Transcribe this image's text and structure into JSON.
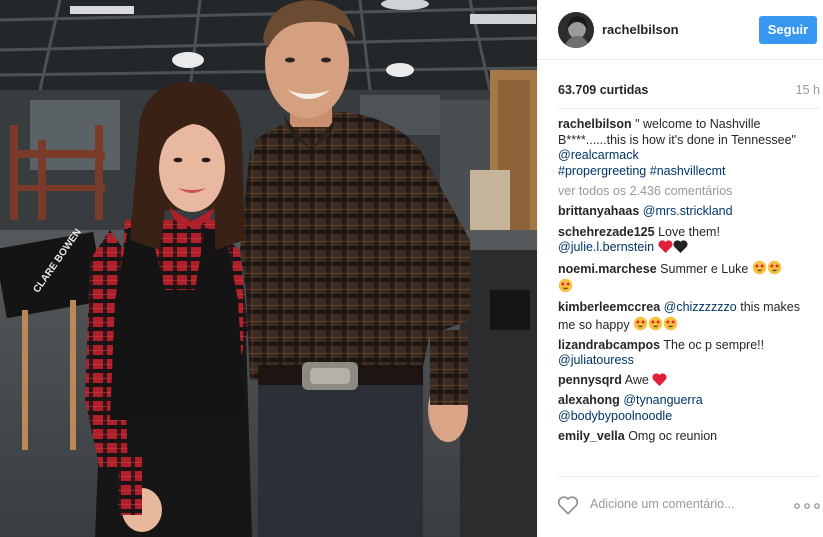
{
  "post": {
    "username": "rachelbilson",
    "follow_label": "Seguir",
    "likes": "63.709 curtidas",
    "time_ago": "15 h",
    "caption": {
      "username": "rachelbilson",
      "text": " \" welcome to Nashville B****......this is how it's done in Tennessee\" ",
      "mention": "@realcarmack",
      "hashtag1": "#propergreeting",
      "hashtag2": "#nashvillecmt"
    },
    "view_all": "ver todos os 2.436 comentários",
    "comments": [
      {
        "user": "brittanyahaas",
        "mention": "@mrs.strickland"
      },
      {
        "user": "schehrezade125",
        "text": "Love them!",
        "mention": "@julie.l.bernstein",
        "emoji": "red-heart black-heart"
      },
      {
        "user": "noemi.marchese",
        "text": "Summer e Luke",
        "emoji": "heart-eyes x3"
      },
      {
        "user": "kimberleemccrea",
        "mention": "@chizzzzzzo",
        "text": " this makes me so happy",
        "emoji": "heart-eyes x3"
      },
      {
        "user": "lizandrabcampos",
        "text": "The oc p sempre!!",
        "mention": "@juliatouress"
      },
      {
        "user": "pennysqrd",
        "text": "Awe",
        "emoji": "red-heart"
      },
      {
        "user": "alexahong",
        "mention": "@tynanguerra",
        "mention2": "@bodybypoolnoodle"
      },
      {
        "user": "emily_vella",
        "text": "Omg oc reunion"
      }
    ],
    "add_comment_placeholder": "Adicione um comentário...",
    "photo_chair_text": "CLARE BOWEN"
  },
  "icons": {
    "like": "heart-outline-icon",
    "more": "more-options-icon"
  },
  "colors": {
    "accent": "#3897f0",
    "link": "#003569",
    "muted": "#999999",
    "text": "#262626"
  }
}
